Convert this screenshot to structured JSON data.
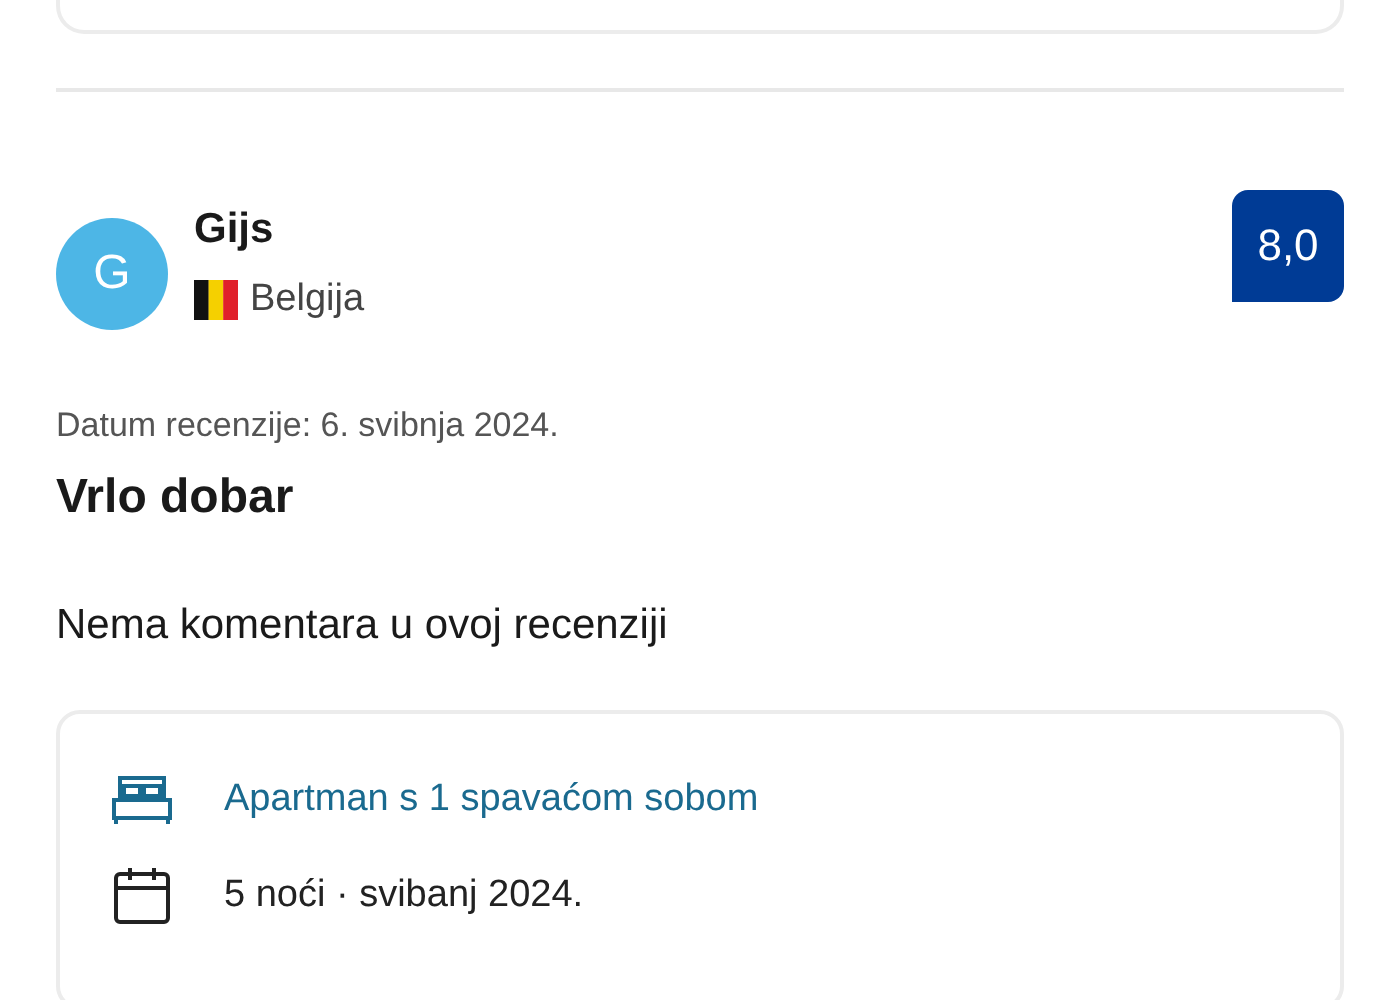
{
  "review": {
    "avatar_letter": "G",
    "name": "Gijs",
    "country": "Belgija",
    "score": "8,0",
    "date": "Datum recenzije: 6. svibnja 2024.",
    "title": "Vrlo dobar",
    "comment": "Nema komentara u ovoj recenziji",
    "details": [
      {
        "kind": "room",
        "text": "Apartman s 1 spavaćom sobom"
      },
      {
        "kind": "stay",
        "text": "5 noći · svibanj 2024."
      }
    ]
  }
}
